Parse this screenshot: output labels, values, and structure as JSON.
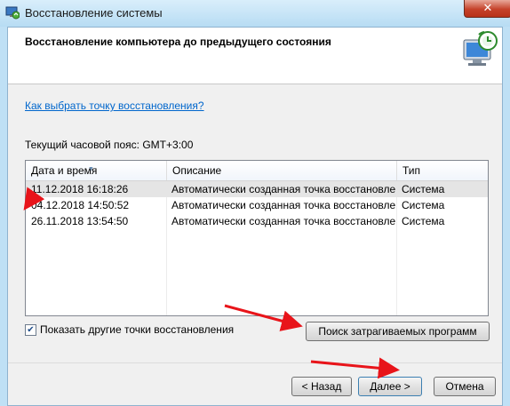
{
  "window": {
    "title": "Восстановление системы",
    "close_symbol": "✕",
    "app_icon": "system-restore-icon"
  },
  "header": {
    "heading": "Восстановление компьютера до предыдущего состояния",
    "icon": "system-restore-monitor-icon"
  },
  "help_link": "Как выбрать точку восстановления?",
  "timezone_label": "Текущий часовой пояс: GMT+3:00",
  "table": {
    "columns": [
      "Дата и время",
      "Описание",
      "Тип"
    ],
    "rows": [
      {
        "date": "11.12.2018 16:18:26",
        "description": "Автоматически созданная точка восстановле...",
        "type": "Система"
      },
      {
        "date": "04.12.2018 14:50:52",
        "description": "Автоматически созданная точка восстановле...",
        "type": "Система"
      },
      {
        "date": "26.11.2018 13:54:50",
        "description": "Автоматически созданная точка восстановле...",
        "type": "Система"
      }
    ]
  },
  "show_more": {
    "label": "Показать другие точки восстановления",
    "checked": true,
    "check_mark": "✔"
  },
  "buttons": {
    "search": "Поиск затрагиваемых программ",
    "back": "< Назад",
    "next": "Далее >",
    "cancel": "Отмена"
  },
  "colors": {
    "annotation_arrow": "#e8141a",
    "link": "#0066cc",
    "close_button": "#c5422a"
  }
}
